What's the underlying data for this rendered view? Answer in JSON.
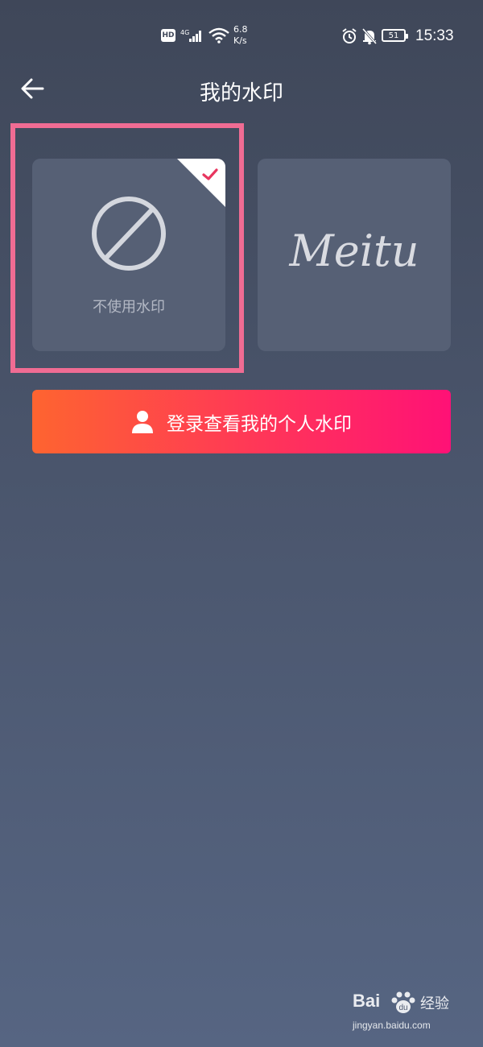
{
  "status_bar": {
    "hd_badge": "HD",
    "network_type": "4G",
    "net_speed_value": "6.8",
    "net_speed_unit": "K/s",
    "battery": "51",
    "time": "15:33"
  },
  "header": {
    "title": "我的水印",
    "back_icon": "arrow-left-icon"
  },
  "watermarks": {
    "options": [
      {
        "label": "不使用水印",
        "icon": "no-symbol-icon",
        "selected": true
      },
      {
        "label": "Meitu",
        "icon": "meitu-script-logo",
        "selected": false
      }
    ]
  },
  "login_button": {
    "label": "登录查看我的个人水印",
    "icon": "user-icon"
  },
  "colors": {
    "highlight": "#f06c93",
    "check": "#e8365f",
    "gradient_start": "#fe6430",
    "gradient_end": "#ff1176"
  },
  "watermark_overlay": {
    "brand": "Bai",
    "brand_cn": "经验",
    "url": "jingyan.baidu.com"
  }
}
